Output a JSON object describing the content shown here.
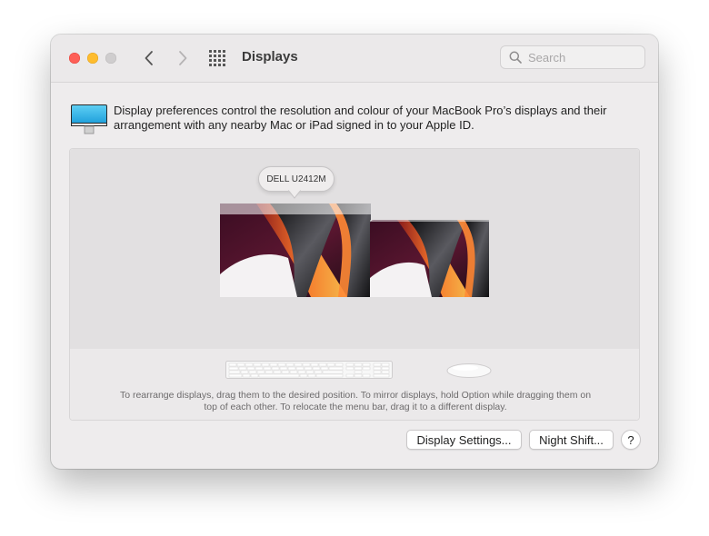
{
  "window": {
    "title": "Displays"
  },
  "toolbar": {
    "back_icon": "chevron-left-icon",
    "forward_icon": "chevron-right-icon",
    "show_all_icon": "grid-icon"
  },
  "search": {
    "placeholder": "Search",
    "value": ""
  },
  "description": "Display preferences control the resolution and colour of your MacBook Pro’s displays and their arrangement with any nearby Mac or iPad signed in to your Apple ID.",
  "arrangement": {
    "tooltip_display_name": "DELL U2412M",
    "hint": "To rearrange displays, drag them to the desired position. To mirror displays, hold Option while dragging them on top of each other. To relocate the menu bar, drag it to a different display."
  },
  "buttons": {
    "display_settings": "Display Settings...",
    "night_shift": "Night Shift...",
    "help": "?"
  },
  "colors": {
    "close": "#fe5f57",
    "minimize": "#febc2e",
    "zoom_disabled": "#cfcdce",
    "window_bg": "#eeeced",
    "arrangement_bg": "#e2e0e1"
  }
}
